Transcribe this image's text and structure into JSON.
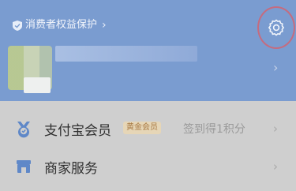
{
  "header": {
    "consumer_protection_label": "消费者权益保护",
    "settings_icon": "gear-icon",
    "shield_icon": "shield-icon"
  },
  "profile": {
    "avatar": "avatar"
  },
  "menu": {
    "items": [
      {
        "label": "支付宝会员",
        "badge": "黄金会员",
        "hint": "签到得1积分",
        "icon": "member-icon"
      },
      {
        "label": "商家服务",
        "icon": "store-icon"
      }
    ]
  },
  "colors": {
    "header_bg": "#7a9cd0",
    "highlight_ring": "#c46c80",
    "badge_bg": "#e6d6b7",
    "badge_text": "#a87a45"
  }
}
